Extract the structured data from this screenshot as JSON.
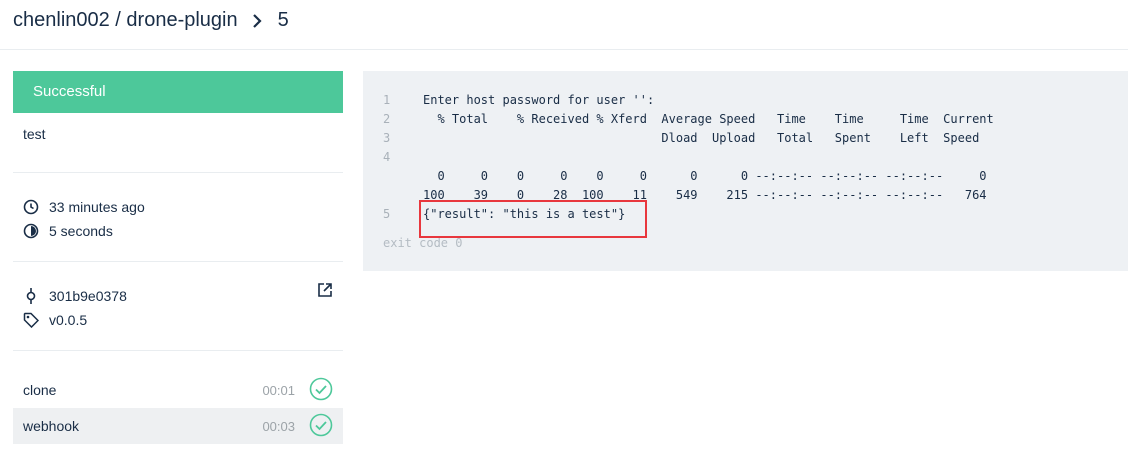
{
  "header": {
    "repo": "chenlin002 / drone-plugin",
    "build_number": "5"
  },
  "sidebar": {
    "status": "Successful",
    "message": "test",
    "created": "33 minutes ago",
    "duration": "5 seconds",
    "commit": "301b9e0378",
    "ref": "v0.0.5",
    "steps": [
      {
        "name": "clone",
        "duration": "00:01",
        "status": "success"
      },
      {
        "name": "webhook",
        "duration": "00:03",
        "status": "success"
      }
    ]
  },
  "console": {
    "lines": [
      {
        "num": "1",
        "text": "Enter host password for user '':"
      },
      {
        "num": "2",
        "text": "  % Total    % Received % Xferd  Average Speed   Time    Time     Time  Current"
      },
      {
        "num": "3",
        "text": "                                 Dload  Upload   Total   Spent    Left  Speed"
      },
      {
        "num": "4",
        "text": ""
      },
      {
        "num": "",
        "text": "  0     0    0     0    0     0      0      0 --:--:-- --:--:-- --:--:--     0"
      },
      {
        "num": "",
        "text": "100    39    0    28  100    11    549    215 --:--:-- --:--:-- --:--:--   764"
      },
      {
        "num": "5",
        "text": "{\"result\": \"this is a test\"}"
      }
    ],
    "exit": "exit code 0"
  },
  "colors": {
    "success": "#4dc89a",
    "highlight": "#e8373d"
  }
}
